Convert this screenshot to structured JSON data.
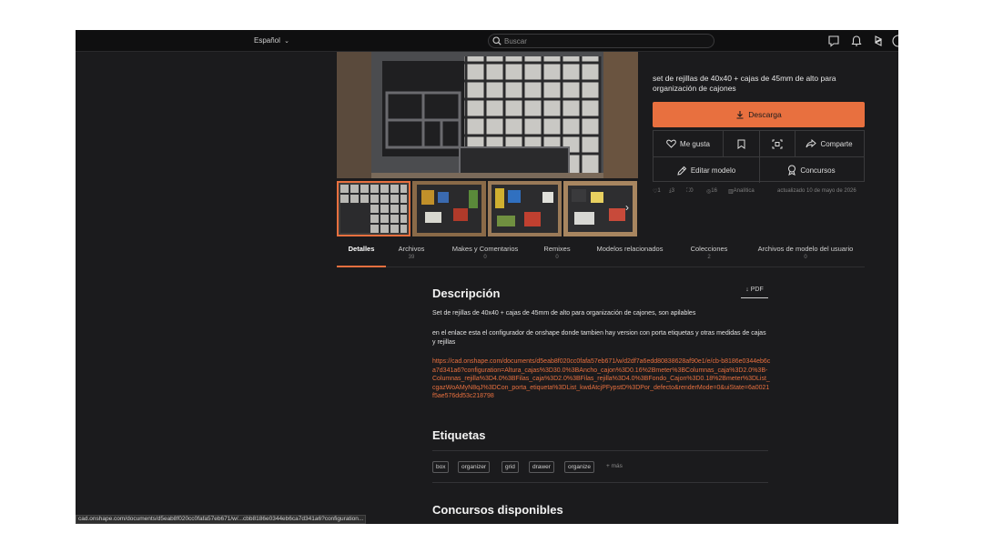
{
  "topbar": {
    "language": "Español",
    "search_placeholder": "Buscar"
  },
  "model": {
    "subtitle": "set de rejillas de 40x40 + cajas de 45mm de alto para organización de cajones",
    "download_label": "Descarga"
  },
  "actions": {
    "like": "Me gusta",
    "share": "Comparte",
    "edit": "Editar modelo",
    "contests": "Concursos"
  },
  "stats": {
    "likes": "1",
    "downloads": "3",
    "makes": "0",
    "views": "16",
    "analytics": "Analítica",
    "updated": "actualizado 10 de mayo de 2026"
  },
  "tabs": [
    {
      "label": "Detalles",
      "count": ""
    },
    {
      "label": "Archivos",
      "count": "39"
    },
    {
      "label": "Makes y Comentarios",
      "count": "0"
    },
    {
      "label": "Remixes",
      "count": "0"
    },
    {
      "label": "Modelos relacionados",
      "count": ""
    },
    {
      "label": "Colecciones",
      "count": "2"
    },
    {
      "label": "Archivos de modelo del usuario",
      "count": "0"
    }
  ],
  "description": {
    "heading": "Descripción",
    "pdf_label": "PDF",
    "para1": "Set de rejillas de 40x40 + cajas de 45mm de alto para organización de cajones, son apilables",
    "para2": "en el enlace esta el configurador de onshape donde tambien hay version con porta etiquetas y otras medidas de cajas y rejillas",
    "link": "https://cad.onshape.com/documents/d5eab8f020cc0fafa57eb671/w/d2df7a6edd80838628af90e1/e/cb-b8186e0344eb6ca7d341a6?configuration=Altura_cajas%3D30.0%3BAncho_cajon%3D0.16%2Bmeter%3BColumnas_caja%3D2.0%3B-Columnas_rejilla%3D4.0%3BFilas_caja%3D2.0%3BFilas_rejilla%3D4.0%3BFondo_Cajon%3D0.18%2Bmeter%3DList_cgazWoAMyN8qJ%3DCon_porta_etiqueta%3DList_kwdAtcjPFypstD%3DPor_defecto&renderMode=0&uiState=6a0021f5ae576dd53c218798"
  },
  "tags_section": {
    "heading": "Etiquetas",
    "tags": [
      "box",
      "organizer",
      "grid",
      "drawer",
      "organize"
    ],
    "more": "+ más"
  },
  "contests_section": {
    "heading": "Concursos disponibles"
  },
  "statusbar": {
    "url": "cad.onshape.com/documents/d5eab8f020cc0fafa57eb671/w/...cbb8186e0344eb6ca7d341a6?configuration..."
  },
  "colors": {
    "accent": "#e8703f",
    "background": "#1b1b1d",
    "topbar": "#0f0f10"
  },
  "icons": {
    "search": "search-icon",
    "messages": "chat-bubble-icon",
    "notifications": "bell-icon",
    "printables": "printables-logo-icon",
    "download": "download-arrow-icon",
    "like": "heart-icon",
    "bookmark": "bookmark-icon",
    "scan": "scan-frame-icon",
    "share": "share-arrow-icon",
    "edit": "edit-pencil-icon",
    "contests": "award-badge-icon"
  }
}
